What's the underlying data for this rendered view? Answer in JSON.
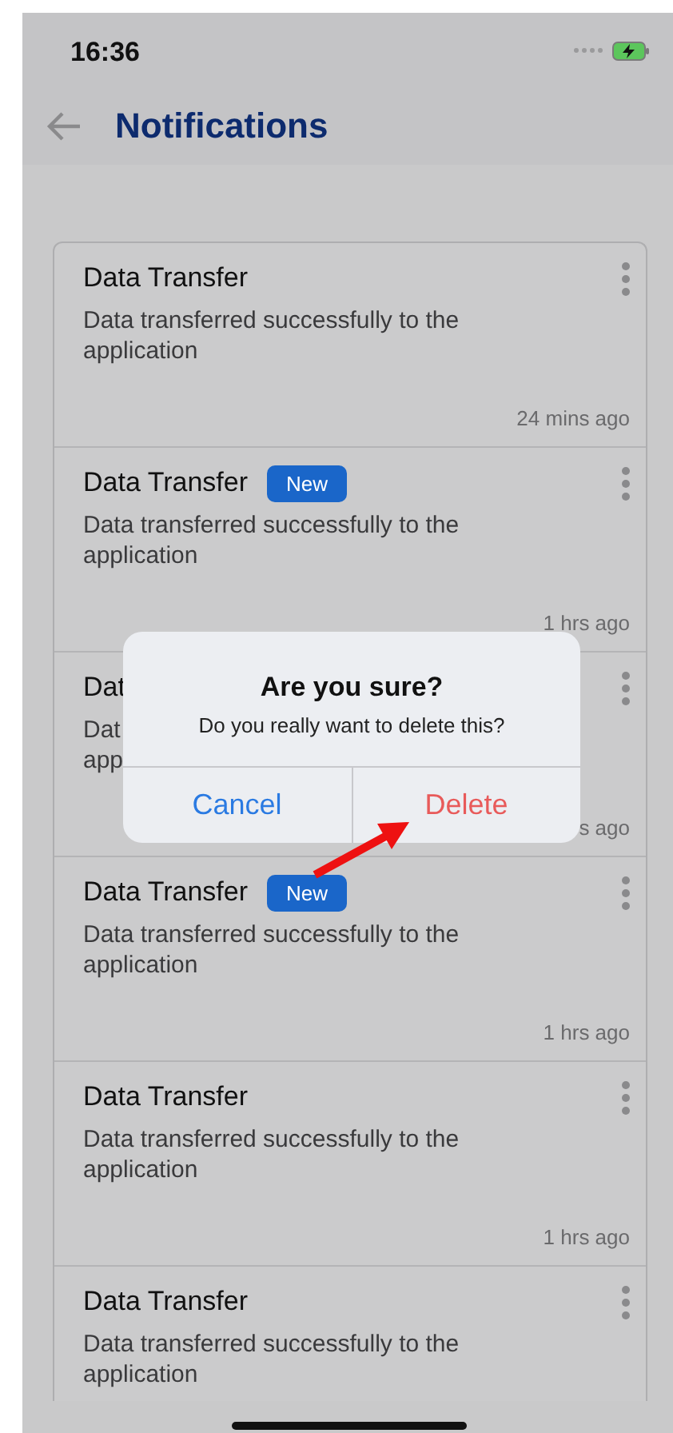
{
  "status_bar": {
    "time": "16:36"
  },
  "header": {
    "title": "Notifications"
  },
  "notifications": [
    {
      "title": "Data Transfer",
      "message_lines": [
        "Data transferred successfully to the",
        "application"
      ],
      "time": "24 mins ago"
    },
    {
      "title": "Data Transfer",
      "badge": "New",
      "message_lines": [
        "Data transferred successfully to the",
        "application"
      ],
      "time": "1 hrs ago"
    },
    {
      "title": "Dat",
      "message_lines": [
        "Dat",
        "app"
      ],
      "time": "s ago"
    },
    {
      "title": "Data Transfer",
      "badge": "New",
      "message_lines": [
        "Data transferred successfully to the",
        "application"
      ],
      "time": "1 hrs ago"
    },
    {
      "title": "Data Transfer",
      "message_lines": [
        "Data transferred successfully to the",
        "application"
      ],
      "time": "1 hrs ago"
    },
    {
      "title": "Data Transfer",
      "message_lines": [
        "Data transferred successfully to the",
        "application"
      ]
    }
  ],
  "dialog": {
    "title": "Are you sure?",
    "message": "Do you really want to delete this?",
    "buttons": [
      {
        "label": "Cancel",
        "kind": "cancel"
      },
      {
        "label": "Delete",
        "kind": "destructive"
      }
    ]
  },
  "annotation": {
    "kind": "arrow"
  }
}
